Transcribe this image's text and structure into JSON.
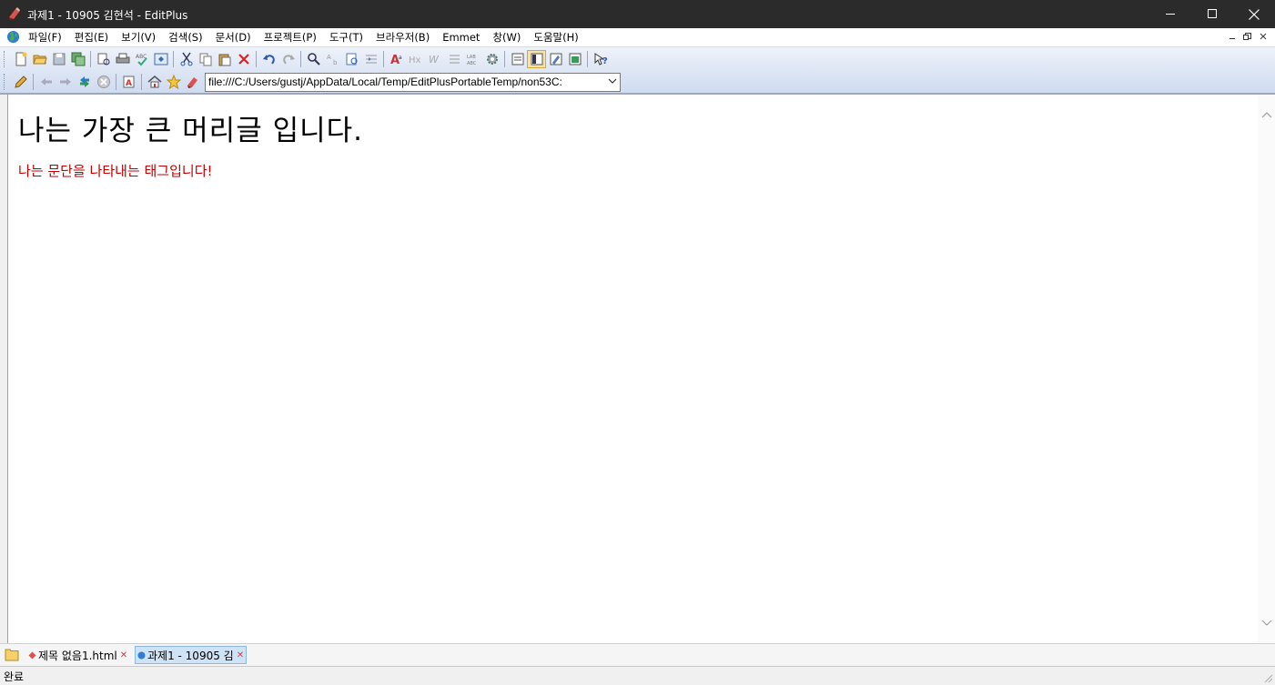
{
  "window": {
    "title": "과제1 - 10905 김현석 - EditPlus"
  },
  "menu": [
    "파일(F)",
    "편집(E)",
    "보기(V)",
    "검색(S)",
    "문서(D)",
    "프로젝트(P)",
    "도구(T)",
    "브라우저(B)",
    "Emmet",
    "창(W)",
    "도움말(H)"
  ],
  "browser": {
    "url": "file:///C:/Users/gustj/AppData/Local/Temp/EditPlusPortableTemp/non53C:"
  },
  "page": {
    "heading": "나는 가장 큰 머리글 입니다.",
    "paragraph": "나는 문단을 나타내는 태그입니다!",
    "paragraph_color": "#c00000"
  },
  "tabs": [
    {
      "label": "제목 없음1.html"
    },
    {
      "label": "과제1 - 10905 김"
    }
  ],
  "status": {
    "text": "완료"
  },
  "colors": {
    "titlebar": "#2b2b2b",
    "tab_active": "#cfe3f7"
  }
}
